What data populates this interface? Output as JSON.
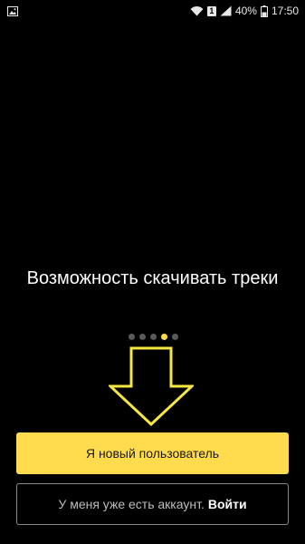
{
  "status_bar": {
    "sim_badge": "1",
    "battery": "40%",
    "time": "17:50",
    "icons": [
      "gallery-icon",
      "wifi-icon",
      "sim-badge-icon",
      "signal-icon",
      "battery-icon"
    ]
  },
  "onboarding": {
    "headline": "Возможность скачивать треки",
    "pager": {
      "total": 5,
      "active_index": 3
    }
  },
  "buttons": {
    "new_user": "Я новый пользователь",
    "existing_prefix": "У меня уже есть аккаунт.",
    "existing_login": "Войти"
  },
  "colors": {
    "accent": "#ffdb4d",
    "background": "#000000",
    "annotation": "#f5e642"
  }
}
